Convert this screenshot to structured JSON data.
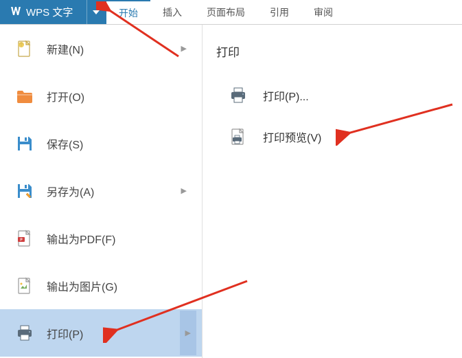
{
  "app": {
    "title": "WPS 文字"
  },
  "tabs": [
    {
      "label": "开始",
      "active": true
    },
    {
      "label": "插入",
      "active": false
    },
    {
      "label": "页面布局",
      "active": false
    },
    {
      "label": "引用",
      "active": false
    },
    {
      "label": "审阅",
      "active": false
    }
  ],
  "sidebar": [
    {
      "label": "新建(N)",
      "icon": "new-doc",
      "hasArrow": true,
      "active": false
    },
    {
      "label": "打开(O)",
      "icon": "folder",
      "hasArrow": false,
      "active": false
    },
    {
      "label": "保存(S)",
      "icon": "save",
      "hasArrow": false,
      "active": false
    },
    {
      "label": "另存为(A)",
      "icon": "save-as",
      "hasArrow": true,
      "active": false
    },
    {
      "label": "输出为PDF(F)",
      "icon": "export-pdf",
      "hasArrow": false,
      "active": false
    },
    {
      "label": "输出为图片(G)",
      "icon": "export-image",
      "hasArrow": false,
      "active": false
    },
    {
      "label": "打印(P)",
      "icon": "printer",
      "hasArrow": true,
      "active": true
    }
  ],
  "panel": {
    "title": "打印",
    "items": [
      {
        "label": "打印(P)...",
        "icon": "printer"
      },
      {
        "label": "打印预览(V)",
        "icon": "print-preview"
      }
    ]
  },
  "colors": {
    "accent": "#2a7ab0",
    "activeBg": "#bed6ef",
    "folder": "#f08c3e",
    "save": "#3a8dcb",
    "printer": "#5a6b7a"
  }
}
